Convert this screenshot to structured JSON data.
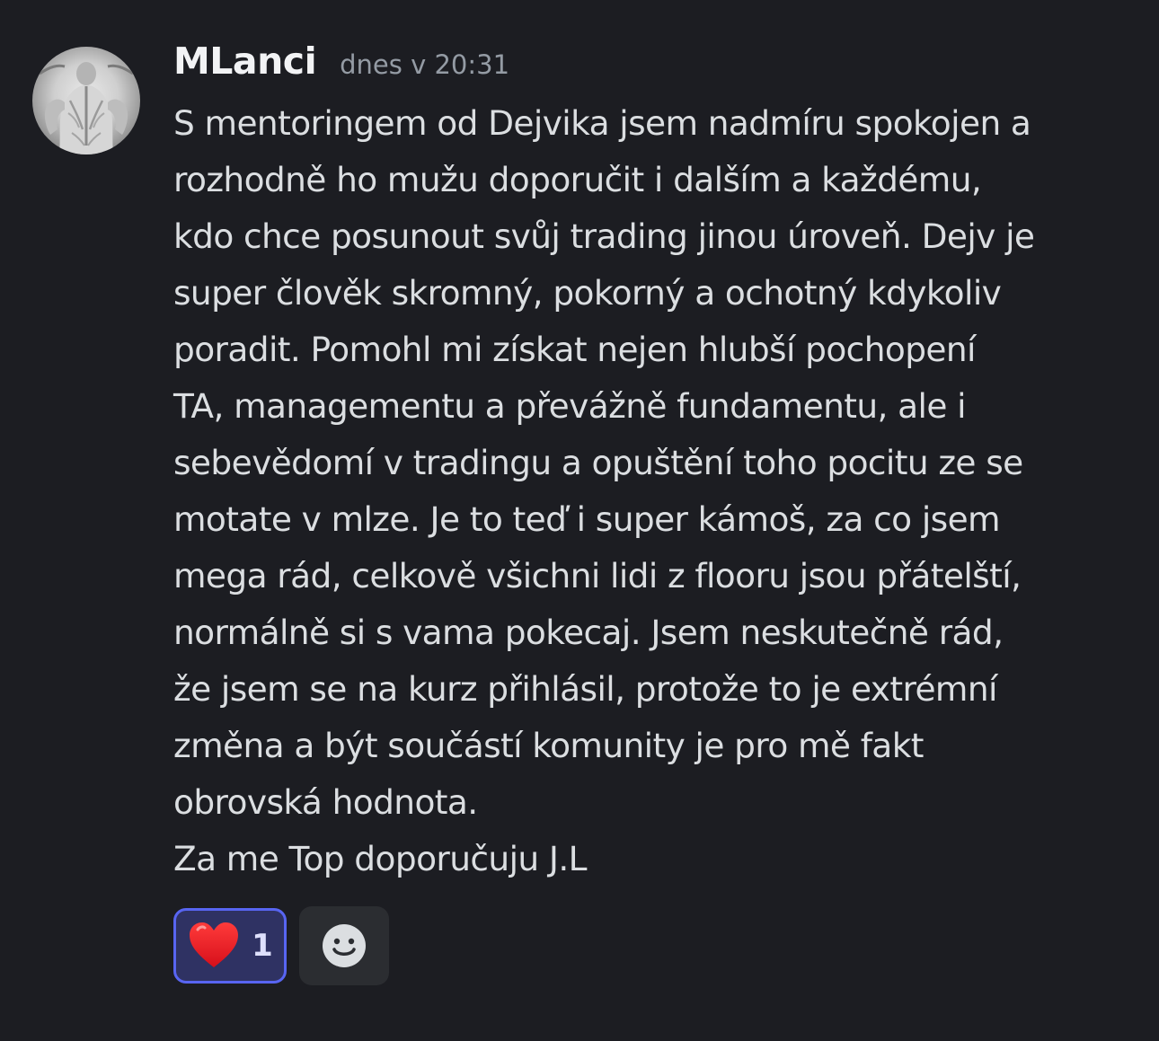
{
  "message": {
    "author": "MLanci",
    "timestamp": "dnes v 20:31",
    "lines": [
      "S mentoringem od Dejvika jsem nadmíru spokojen a",
      "rozhodně ho mužu doporučit i dalším a každému,",
      "kdo chce posunout svůj trading jinou úroveň. Dejv je",
      "super člověk skromný, pokorný a ochotný kdykoliv",
      "poradit. Pomohl mi získat nejen hlubší pochopení",
      "TA, managementu a převážně fundamentu, ale i",
      "sebevědomí v tradingu a opuštění toho pocitu ze se",
      "motate v mlze. Je to teď i super kámoš, za co jsem",
      "mega rád, celkově všichni lidi z flooru jsou přátelští,",
      "normálně si s vama pokecaj. Jsem neskutečně rád,",
      "že jsem se na kurz přihlásil, protože to je extrémní",
      "změna a být součástí komunity je pro mě fakt",
      "obrovská hodnota.",
      "Za me Top doporučuju J.L"
    ]
  },
  "reactions": [
    {
      "emoji": "❤️",
      "icon": "red-heart-icon",
      "count": "1",
      "reacted": true
    }
  ],
  "add_reaction": {
    "icon": "smiley-face-icon"
  },
  "colors": {
    "background": "#1c1d22",
    "username": "#f2f3f5",
    "text": "#dbdee1",
    "timestamp": "#949ba4",
    "reaction_accent": "#5865f2"
  }
}
